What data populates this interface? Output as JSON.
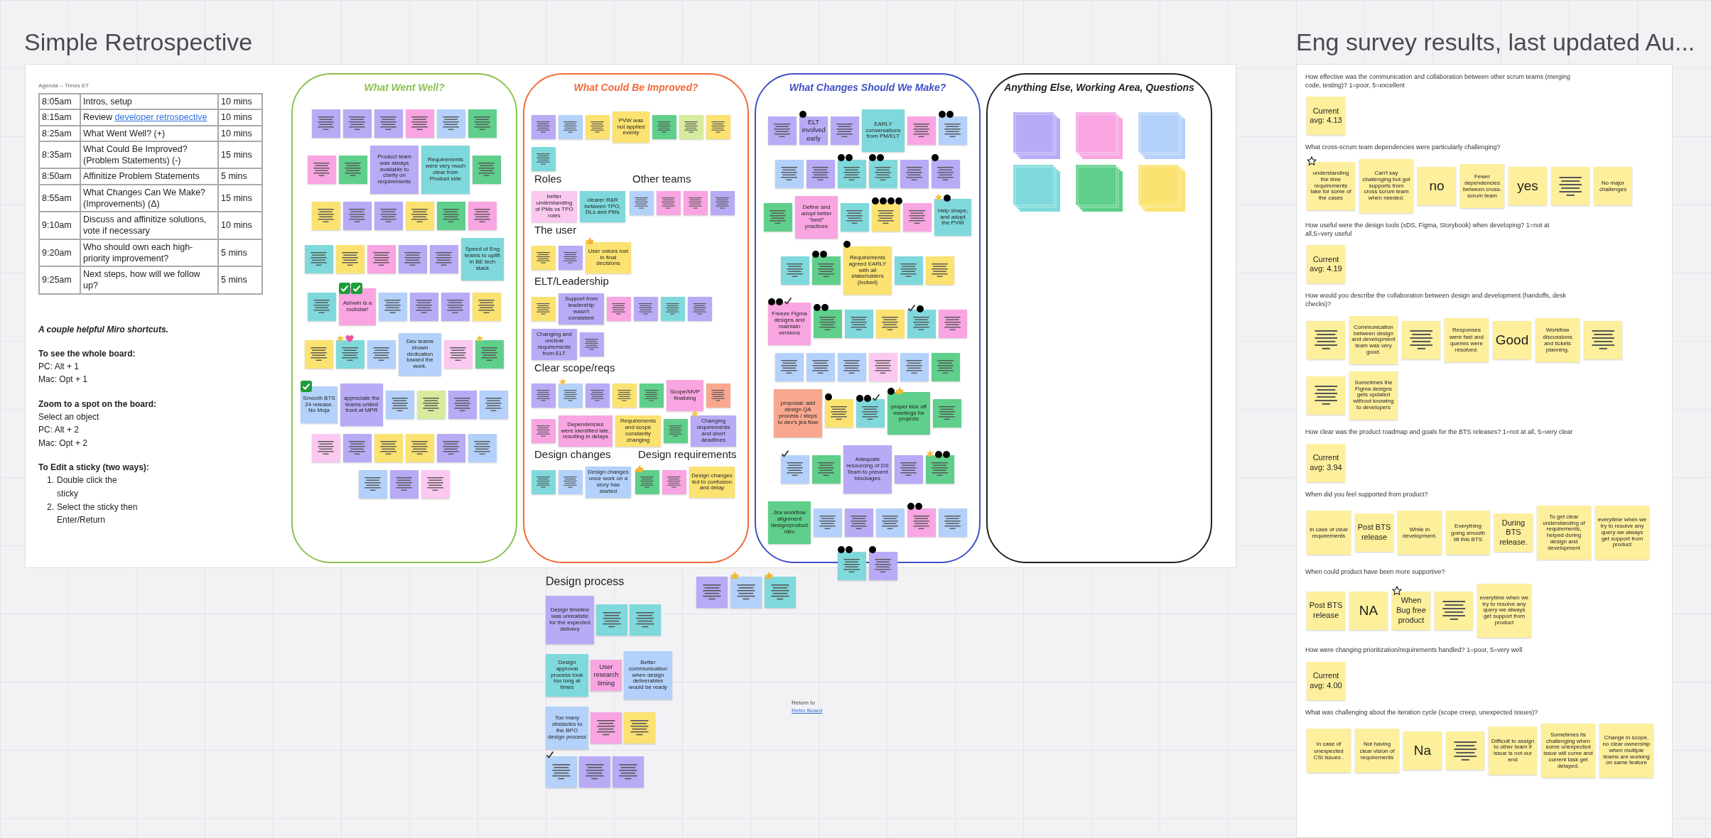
{
  "board": {
    "title": "Simple Retrospective",
    "agenda": {
      "caption": "Agenda -- Times ET",
      "rows": [
        {
          "time": "8:05am",
          "item": "Intros, setup",
          "duration": "10 mins"
        },
        {
          "time": "8:15am",
          "item": "Review",
          "link": "developer retrospective",
          "duration": "10 mins"
        },
        {
          "time": "8:25am",
          "item": "What Went Well?  (+)",
          "duration": "10 mins"
        },
        {
          "time": "8:35am",
          "item": "What Could Be Improved? (Problem Statements)  (-)",
          "duration": "15 mins"
        },
        {
          "time": "8:50am",
          "item": "Affinitize Problem Statements",
          "duration": "5 mins"
        },
        {
          "time": "8:55am",
          "item": "What Changes Can We Make? (Improvements)  (Δ)",
          "duration": "15 mins"
        },
        {
          "time": "9:10am",
          "item": "Discuss and affinitize solutions, vote if necessary",
          "duration": "10 mins"
        },
        {
          "time": "9:20am",
          "item": "Who should own each high-priority improvement?",
          "duration": "5 mins"
        },
        {
          "time": "9:25am",
          "item": "Next steps, how will we follow up?",
          "duration": "5 mins"
        }
      ]
    },
    "shortcuts": {
      "heading": "A couple helpful Miro shortcuts.",
      "sections": [
        {
          "title": "To see the whole board:",
          "lines": [
            "PC: Alt + 1",
            "Mac: Opt + 1"
          ]
        },
        {
          "title": "Zoom to a spot on the board:",
          "lines": [
            "Select an object",
            "PC:  Alt + 2",
            "Mac: Opt + 2"
          ]
        },
        {
          "title": "To Edit a sticky (two ways):",
          "steps": [
            {
              "number": "1.",
              "text": "Double click the sticky"
            },
            {
              "number": "2.",
              "text": "Select the sticky then Enter/Return"
            }
          ]
        }
      ]
    },
    "columns": [
      {
        "title": "What Went Well?",
        "color": "#8cc152",
        "groups": [
          {
            "notes": [
              {
                "color": "#b9aaf6"
              },
              {
                "color": "#b9aaf6"
              },
              {
                "color": "#b9aaf6"
              },
              {
                "color": "#f8a5e2"
              },
              {
                "color": "#b3d1fa"
              },
              {
                "color": "#5fcf8b"
              },
              {
                "color": "#f8a5e2"
              },
              {
                "color": "#5fcf8b"
              },
              {
                "color": "#b9aaf6",
                "text": "Product team was always available to clarify on requirements"
              },
              {
                "color": "#7fd9dc",
                "text": "Requirements were very much clear from Product side"
              },
              {
                "color": "#5fcf8b"
              },
              {
                "color": "#fbe271"
              },
              {
                "color": "#b9aaf6"
              },
              {
                "color": "#b9aaf6"
              },
              {
                "color": "#fbe271"
              },
              {
                "color": "#5fcf8b"
              },
              {
                "color": "#f8a5e2"
              },
              {
                "color": "#7fd9dc"
              },
              {
                "color": "#fbe271"
              },
              {
                "color": "#f8a5e2"
              },
              {
                "color": "#b9aaf6"
              },
              {
                "color": "#b9aaf6"
              },
              {
                "color": "#7fd9dc",
                "text": "Speed of Eng teams to uplift in BE tech stack"
              },
              {
                "color": "#7fd9dc"
              },
              {
                "color": "#f8a5e2",
                "text": "Ashwin is a rockstar!",
                "marks": [
                  {
                    "kind": "check"
                  },
                  {
                    "kind": "check"
                  }
                ]
              },
              {
                "color": "#b3d1fa"
              },
              {
                "color": "#b9aaf6"
              },
              {
                "color": "#b9aaf6"
              },
              {
                "color": "#fbe271"
              },
              {
                "color": "#fbe271"
              },
              {
                "color": "#7fd9dc",
                "marks": [
                  {
                    "kind": "star"
                  },
                  {
                    "kind": "heart"
                  }
                ]
              },
              {
                "color": "#b3d1fa"
              },
              {
                "color": "#b3d1fa",
                "text": "Dev teams shown dedication toward the work."
              },
              {
                "color": "#fbc8ef"
              },
              {
                "color": "#5fcf8b",
                "marks": [
                  {
                    "kind": "star"
                  }
                ]
              },
              {
                "color": "#b3d1fa",
                "text": "Smooth BTS 24 release. No Moja",
                "marks": [
                  {
                    "kind": "check"
                  }
                ]
              },
              {
                "color": "#b9aaf6",
                "text": "appreciate the teams united front at MPR"
              },
              {
                "color": "#b3d1fa"
              },
              {
                "color": "#d6ec9c"
              },
              {
                "color": "#b9aaf6"
              },
              {
                "color": "#b3d1fa"
              },
              {
                "color": "#fbc8ef"
              },
              {
                "color": "#b9aaf6"
              },
              {
                "color": "#fbe271"
              },
              {
                "color": "#fbe271"
              },
              {
                "color": "#b9aaf6"
              },
              {
                "color": "#b3d1fa"
              },
              {
                "color": "#b3d1fa"
              },
              {
                "color": "#b9aaf6"
              },
              {
                "color": "#fbc8ef"
              }
            ]
          }
        ]
      },
      {
        "title": "What Could Be Improved?",
        "color": "#f26b3a",
        "groups": [
          {
            "notes": [
              {
                "color": "#b9aaf6"
              },
              {
                "color": "#b3d1fa"
              },
              {
                "color": "#fbe271"
              },
              {
                "color": "#fbe271",
                "text": "PVW was not applied evenly"
              },
              {
                "color": "#5fcf8b"
              },
              {
                "color": "#d6ec9c"
              },
              {
                "color": "#fbe271"
              },
              {
                "color": "#7fd9dc"
              }
            ]
          },
          {
            "heading": "Roles",
            "notes": [
              {
                "color": "#fbc8ef",
                "text": "better understanding of PMs vs TPO roles"
              },
              {
                "color": "#7fd9dc",
                "text": "clearer R&R between TPO, DLs and PMs"
              }
            ]
          },
          {
            "heading": "Other teams",
            "notes": [
              {
                "color": "#b3d1fa"
              },
              {
                "color": "#f8a5e2"
              },
              {
                "color": "#f8a5e2"
              },
              {
                "color": "#b9aaf6"
              }
            ]
          },
          {
            "heading": "The user",
            "notes": [
              {
                "color": "#fbe271"
              },
              {
                "color": "#b9aaf6"
              },
              {
                "color": "#fbe271",
                "text": "User voices lost in final decisions",
                "marks": [
                  {
                    "kind": "thumb"
                  }
                ]
              }
            ]
          },
          {
            "heading": "ELT/Leadership",
            "notes": [
              {
                "color": "#fbe271"
              },
              {
                "color": "#b9aaf6",
                "text": "Support from leadership wasn't consistent"
              },
              {
                "color": "#f8a5e2"
              },
              {
                "color": "#b9aaf6"
              },
              {
                "color": "#7fd9dc"
              },
              {
                "color": "#b9aaf6"
              },
              {
                "color": "#b9aaf6",
                "text": "Changing and unclear requirements from ELT"
              },
              {
                "color": "#b9aaf6"
              }
            ]
          },
          {
            "heading": "Clear scope/reqs",
            "notes": [
              {
                "color": "#b9aaf6"
              },
              {
                "color": "#b3d1fa",
                "marks": [
                  {
                    "kind": "star"
                  }
                ]
              },
              {
                "color": "#b9aaf6"
              },
              {
                "color": "#fbe271"
              },
              {
                "color": "#5fcf8b"
              },
              {
                "color": "#f8a5e2",
                "text": "Scope/MVP finalizing"
              },
              {
                "color": "#f9a88f"
              },
              {
                "color": "#f8a5e2"
              },
              {
                "color": "#f8a5e2",
                "text": "Dependencies were identified late, resulting in delays"
              },
              {
                "color": "#fbe271",
                "text": "Requirements and scope constantly changing"
              },
              {
                "color": "#5fcf8b"
              },
              {
                "color": "#b9aaf6",
                "text": "Changing requirements and short deadlines",
                "marks": [
                  {
                    "kind": "star"
                  }
                ]
              }
            ]
          },
          {
            "heading": "Design changes",
            "notes": [
              {
                "color": "#7fd9dc"
              },
              {
                "color": "#b3d1fa"
              },
              {
                "color": "#b3d1fa",
                "text": "Design changes once work on a story has started"
              }
            ]
          },
          {
            "heading": "Design requirements",
            "notes": [
              {
                "color": "#5fcf8b",
                "marks": [
                  {
                    "kind": "thumb"
                  }
                ]
              },
              {
                "color": "#f8a5e2"
              },
              {
                "color": "#fbe271",
                "text": "Design changes led to confusion and delay"
              }
            ]
          }
        ]
      },
      {
        "title": "What Changes Should We Make?",
        "color": "#3f51c4",
        "groups": [
          {
            "notes": [
              {
                "color": "#b9aaf6"
              },
              {
                "color": "#b9aaf6",
                "text": "ELT involved early",
                "marks": [
                  {
                    "kind": "dot"
                  }
                ]
              },
              {
                "color": "#b9aaf6"
              },
              {
                "color": "#7fd9dc",
                "text": "EARLY conversations from PM/ELT"
              },
              {
                "color": "#f8a5e2"
              },
              {
                "color": "#b3d1fa",
                "marks": [
                  {
                    "kind": "dot"
                  },
                  {
                    "kind": "dot"
                  }
                ]
              },
              {
                "color": "#b3d1fa"
              },
              {
                "color": "#b9aaf6"
              },
              {
                "color": "#7fd9dc",
                "marks": [
                  {
                    "kind": "dot"
                  },
                  {
                    "kind": "dot"
                  }
                ]
              },
              {
                "color": "#7fd9dc",
                "marks": [
                  {
                    "kind": "dot"
                  },
                  {
                    "kind": "dot"
                  }
                ]
              },
              {
                "color": "#b9aaf6"
              },
              {
                "color": "#b9aaf6",
                "marks": [
                  {
                    "kind": "dot"
                  }
                ]
              },
              {
                "color": "#5fcf8b"
              },
              {
                "color": "#f8a5e2",
                "text": "Define and adopt better \"best\" practices"
              },
              {
                "color": "#7fd9dc"
              },
              {
                "color": "#fbe271",
                "marks": [
                  {
                    "kind": "dot"
                  },
                  {
                    "kind": "dot"
                  },
                  {
                    "kind": "dot"
                  },
                  {
                    "kind": "dot"
                  }
                ]
              },
              {
                "color": "#f8a5e2"
              },
              {
                "color": "#7fd9dc",
                "text": "Help shape, and adopt the PVW",
                "marks": [
                  {
                    "kind": "star"
                  },
                  {
                    "kind": "dot"
                  }
                ]
              },
              {
                "color": "#7fd9dc"
              },
              {
                "color": "#5fcf8b",
                "marks": [
                  {
                    "kind": "dot"
                  },
                  {
                    "kind": "dot"
                  }
                ]
              },
              {
                "color": "#fbe271",
                "text": "Requirements agreed EARLY with all stakeholders (locked)",
                "marks": [
                  {
                    "kind": "dot"
                  }
                ]
              },
              {
                "color": "#7fd9dc"
              },
              {
                "color": "#fbe271"
              },
              {
                "color": "#f8a5e2",
                "text": "Freeze Figma designs and maintain versions",
                "marks": [
                  {
                    "kind": "dot"
                  },
                  {
                    "kind": "dot"
                  },
                  {
                    "kind": "tick"
                  }
                ]
              },
              {
                "color": "#5fcf8b",
                "marks": [
                  {
                    "kind": "dot"
                  },
                  {
                    "kind": "dot"
                  }
                ]
              },
              {
                "color": "#7fd9dc"
              },
              {
                "color": "#fbe271"
              },
              {
                "color": "#7fd9dc",
                "marks": [
                  {
                    "kind": "tick"
                  },
                  {
                    "kind": "dot"
                  }
                ]
              },
              {
                "color": "#f8a5e2"
              },
              {
                "color": "#b3d1fa"
              },
              {
                "color": "#b3d1fa"
              },
              {
                "color": "#b3d1fa"
              },
              {
                "color": "#fbc8ef"
              },
              {
                "color": "#b3d1fa"
              },
              {
                "color": "#5fcf8b"
              },
              {
                "color": "#f9a88f",
                "text": "proposal: add design QA process / steps to dev's jira flow"
              },
              {
                "color": "#fbe271",
                "marks": [
                  {
                    "kind": "dot"
                  }
                ]
              },
              {
                "color": "#7fd9dc",
                "marks": [
                  {
                    "kind": "dot"
                  },
                  {
                    "kind": "dot"
                  },
                  {
                    "kind": "tick"
                  }
                ]
              },
              {
                "color": "#5fcf8b",
                "text": "proper kick off meetings for projects",
                "marks": [
                  {
                    "kind": "dot"
                  },
                  {
                    "kind": "thumb"
                  }
                ]
              },
              {
                "color": "#5fcf8b"
              },
              {
                "color": "#b3d1fa",
                "marks": [
                  {
                    "kind": "tick"
                  }
                ]
              },
              {
                "color": "#5fcf8b"
              },
              {
                "color": "#b9aaf6",
                "text": "Adequate resourcing of DS Team to prevent blockages"
              },
              {
                "color": "#b9aaf6"
              },
              {
                "color": "#5fcf8b",
                "marks": [
                  {
                    "kind": "star"
                  },
                  {
                    "kind": "dot"
                  },
                  {
                    "kind": "dot"
                  }
                ]
              },
              {
                "color": "#5fcf8b",
                "text": "Jira workflow alignment design/product/dev"
              },
              {
                "color": "#b3d1fa"
              },
              {
                "color": "#b9aaf6"
              },
              {
                "color": "#b3d1fa"
              },
              {
                "color": "#f8a5e2",
                "marks": [
                  {
                    "kind": "dot"
                  },
                  {
                    "kind": "dot"
                  }
                ]
              },
              {
                "color": "#b3d1fa"
              },
              {
                "color": "#7fd9dc",
                "marks": [
                  {
                    "kind": "dot"
                  },
                  {
                    "kind": "dot"
                  }
                ]
              },
              {
                "color": "#b9aaf6",
                "marks": [
                  {
                    "kind": "dot"
                  }
                ]
              }
            ]
          }
        ]
      },
      {
        "title": "Anything Else, Working Area, Questions",
        "color": "#222222",
        "stacks": [
          {
            "color": "#b9aaf6"
          },
          {
            "color": "#f8a5e2"
          },
          {
            "color": "#b3d1fa"
          },
          {
            "color": "#7fd9dc"
          },
          {
            "color": "#5fcf8b"
          },
          {
            "color": "#fbe271"
          }
        ]
      }
    ],
    "design_process": {
      "heading": "Design process",
      "notes": [
        {
          "color": "#b9aaf6",
          "text": "Design timeline was unrealistic for the expected delivery"
        },
        {
          "color": "#7fd9dc"
        },
        {
          "color": "#7fd9dc"
        },
        {
          "color": "#7fd9dc",
          "text": "Design approval process took too long at times"
        },
        {
          "color": "#f8a5e2",
          "text": "User research timing"
        },
        {
          "color": "#b3d1fa",
          "text": "Better communication when design deliverables would be ready"
        },
        {
          "color": "#b3d1fa",
          "text": "Too many obstacles to the BPO design process"
        },
        {
          "color": "#f8a5e2"
        },
        {
          "color": "#fbe271"
        },
        {
          "color": "#b3d1fa",
          "marks": [
            {
              "kind": "tick"
            }
          ]
        },
        {
          "color": "#b9aaf6"
        },
        {
          "color": "#b9aaf6"
        }
      ]
    },
    "loose_notes": [
      {
        "color": "#b9aaf6"
      },
      {
        "color": "#b3d1fa",
        "marks": [
          {
            "kind": "thumb"
          }
        ]
      },
      {
        "color": "#7fd9dc",
        "marks": [
          {
            "kind": "thumb"
          }
        ]
      }
    ],
    "return_link": {
      "text": "Return to",
      "link": "Retro Board"
    }
  },
  "survey": {
    "title": "Eng survey results, last updated Au...",
    "questions": [
      {
        "question": "How effective was the communication and collaboration between other scrum teams (merging code, testing)? 1=poor, 5=excellent",
        "notes": [
          {
            "text": "Current avg: 4.13"
          }
        ]
      },
      {
        "question": "What cross-scrum team dependencies were particularly challenging?",
        "notes": [
          {
            "text": "understanding the time requirements take for some of the cases",
            "marks": [
              {
                "kind": "star_outline"
              }
            ]
          },
          {
            "text": "Can't say challenging but got supports from cross scrum team when needed."
          },
          {
            "text": "no"
          },
          {
            "text": "Fewer dependencies between cross-scrum team"
          },
          {
            "text": "yes"
          },
          {
            "kind": "lines"
          },
          {
            "text": "No major challenges"
          }
        ]
      },
      {
        "question": "How useful were the design tools (xDS, Figma, Storybook) when developing? 1=not at all,5=very useful",
        "notes": [
          {
            "text": "Current avg: 4.19"
          }
        ]
      },
      {
        "question": "How would you describe the collaboration between design and development (handoffs, desk checks)?",
        "notes": [
          {
            "kind": "lines"
          },
          {
            "text": "Communication between design and development team was very good."
          },
          {
            "kind": "lines"
          },
          {
            "text": "Responses were fast and queries were resolved."
          },
          {
            "text": "Good"
          },
          {
            "text": "Workflow discussions and tickets planning."
          },
          {
            "kind": "lines"
          },
          {
            "kind": "lines"
          },
          {
            "text": "Sometimes the Figma designs gets updated without knowing to developers"
          }
        ]
      },
      {
        "question": "How clear was the product roadmap and goals for the BTS releases? 1=not at all, 5=very clear",
        "notes": [
          {
            "text": "Current avg: 3.94"
          }
        ]
      },
      {
        "question": "When did you feel supported from product?",
        "notes": [
          {
            "text": "In case of clear requirements"
          },
          {
            "text": "Post BTS release"
          },
          {
            "text": "While in development."
          },
          {
            "text": "Everything going smooth till this BTS"
          },
          {
            "text": "During BTS release."
          },
          {
            "text": "To get clear understanding of requirements, helped during design and development"
          },
          {
            "text": "everytime when we try to resolve any query we always get support from product"
          }
        ]
      },
      {
        "question": "When could product have been more supportive?",
        "notes": [
          {
            "text": "Post BTS release"
          },
          {
            "text": "NA"
          },
          {
            "text": "When Bug free product",
            "marks": [
              {
                "kind": "star_outline"
              }
            ]
          },
          {
            "kind": "lines"
          },
          {
            "text": "everytime when we try to resolve any query we always get support from product"
          }
        ]
      },
      {
        "question": "How were changing prioritization/requirements handled? 1=poor, 5=very well",
        "notes": [
          {
            "text": "Current avg: 4.00"
          }
        ]
      },
      {
        "question": "What was challenging about the iteration cycle (scope creep, unexpected issues)?",
        "notes": [
          {
            "text": "In case of unexpected CSI issues ."
          },
          {
            "text": "Not having clear vision of requirements"
          },
          {
            "text": "Na"
          },
          {
            "kind": "lines"
          },
          {
            "text": "Difficult to assign to other team if issue is not our end"
          },
          {
            "text": "Sometimes its challenging when some unexpected issue will come and current task get delayed."
          },
          {
            "text": "Change in scope, no clear ownership when multiple teams are working on same feature"
          }
        ]
      }
    ]
  }
}
